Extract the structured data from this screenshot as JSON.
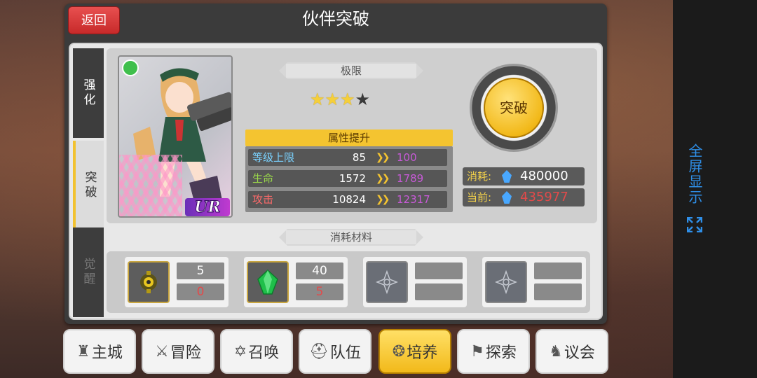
{
  "screen": {
    "title": "伙伴突破",
    "back_label": "返回"
  },
  "side_tabs": [
    {
      "label": "强化",
      "state": "normal"
    },
    {
      "label": "突破",
      "state": "active"
    },
    {
      "label": "觉醒",
      "state": "disabled"
    }
  ],
  "card": {
    "rarity": "UR",
    "element_icon": "leaf-icon"
  },
  "limit": {
    "label": "极限",
    "stars_filled": 3,
    "stars_total": 4
  },
  "attributes": {
    "header": "属性提升",
    "rows": [
      {
        "name": "等级上限",
        "old": "85",
        "new": "100",
        "name_color": "#7ad2ff"
      },
      {
        "name": "生命",
        "old": "1572",
        "new": "1789",
        "name_color": "#9ad84a"
      },
      {
        "name": "攻击",
        "old": "10824",
        "new": "12317",
        "name_color": "#ff6a6a"
      }
    ]
  },
  "breakthrough": {
    "button_label": "突破",
    "cost_label": "消耗:",
    "cost_value": "480000",
    "current_label": "当前:",
    "current_value": "435977"
  },
  "materials": {
    "label": "消耗材料",
    "slots": [
      {
        "icon": "gear-ore-icon",
        "required": "5",
        "owned": "0"
      },
      {
        "icon": "green-gem-icon",
        "required": "40",
        "owned": "5"
      },
      {
        "icon": "empty-slot-icon",
        "required": "",
        "owned": ""
      },
      {
        "icon": "empty-slot-icon",
        "required": "",
        "owned": ""
      }
    ]
  },
  "bottom_nav": [
    {
      "label": "主城",
      "icon": "castle-icon",
      "active": false
    },
    {
      "label": "冒险",
      "icon": "crossed-swords-icon",
      "active": false
    },
    {
      "label": "召唤",
      "icon": "hexagram-icon",
      "active": false
    },
    {
      "label": "队伍",
      "icon": "helmet-icon",
      "active": false
    },
    {
      "label": "培养",
      "icon": "triple-circle-icon",
      "active": true
    },
    {
      "label": "探索",
      "icon": "explorer-icon",
      "active": false
    },
    {
      "label": "议会",
      "icon": "dragon-icon",
      "active": false
    }
  ],
  "side_panel": {
    "fullscreen_label": "全屏显示"
  },
  "colors": {
    "accent_yellow": "#f4c430",
    "upgrade_purple": "#c85ad8",
    "insufficient_red": "#e34a4a",
    "panel_dark": "#3b3b3b",
    "fullscreen_blue": "#2f8fe8"
  }
}
